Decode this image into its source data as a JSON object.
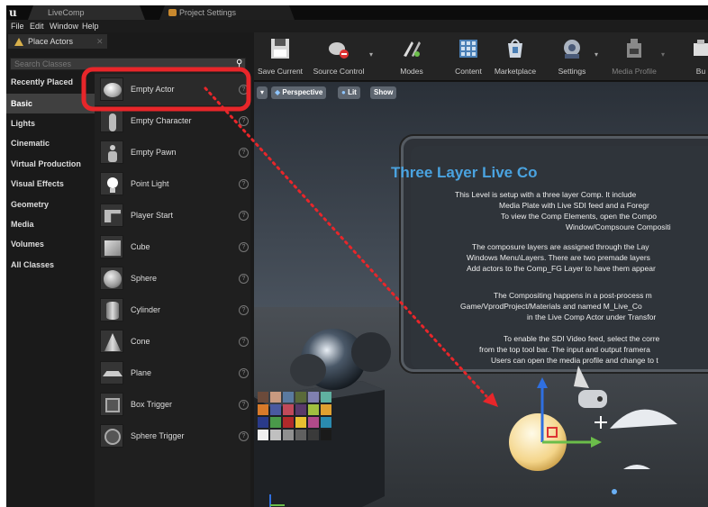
{
  "window_tabs": [
    {
      "label": "LiveComp"
    },
    {
      "label": "Project Settings"
    }
  ],
  "menu": [
    "File",
    "Edit",
    "Window",
    "Help"
  ],
  "place_actors": {
    "tab_label": "Place Actors",
    "search_placeholder": "Search Classes",
    "categories": [
      "Recently Placed",
      "Basic",
      "Lights",
      "Cinematic",
      "Virtual Production",
      "Visual Effects",
      "Geometry",
      "Media",
      "Volumes",
      "All Classes"
    ],
    "selected_category": "Basic",
    "items": [
      "Empty Actor",
      "Empty Character",
      "Empty Pawn",
      "Point Light",
      "Player Start",
      "Cube",
      "Sphere",
      "Cylinder",
      "Cone",
      "Plane",
      "Box Trigger",
      "Sphere Trigger"
    ],
    "highlighted_item": "Empty Actor"
  },
  "toolbar": [
    {
      "label": "Save Current",
      "icon": "save-icon"
    },
    {
      "label": "Source Control",
      "icon": "source-control-icon"
    },
    {
      "label": "Modes",
      "icon": "modes-icon"
    },
    {
      "label": "Content",
      "icon": "content-icon"
    },
    {
      "label": "Marketplace",
      "icon": "marketplace-icon"
    },
    {
      "label": "Settings",
      "icon": "settings-icon"
    },
    {
      "label": "Media Profile",
      "icon": "media-profile-icon"
    },
    {
      "label": "Bu",
      "icon": "build-icon"
    }
  ],
  "viewport": {
    "perspective_label": "Perspective",
    "lit_label": "Lit",
    "show_label": "Show",
    "panel_title": "Three Layer Live Co",
    "panel_text": [
      "This Level is setup with a three layer Comp.  It include",
      "Media Plate with Live SDI feed and a Foregr",
      "To view the Comp Elements, open the Compo",
      "Window/Compsoure Compositi",
      "The composure layers are assigned through the Lay",
      "Windows Menu\\Layers.  There are two premade layers",
      "Add actors to the Comp_FG Layer to have them appear",
      "The Compositing happens in a post-process m",
      "Game/VprodProject/Materials and named M_Live_Co",
      "in the Live Comp Actor under Transfor",
      "To enable the SDI Video feed, select the corre",
      "from the top tool bar. The input and output framera",
      "Users can open the media profile and change to t"
    ]
  },
  "colors": {
    "annotation_red": "#e8262a",
    "title_blue": "#4aa3e0"
  }
}
